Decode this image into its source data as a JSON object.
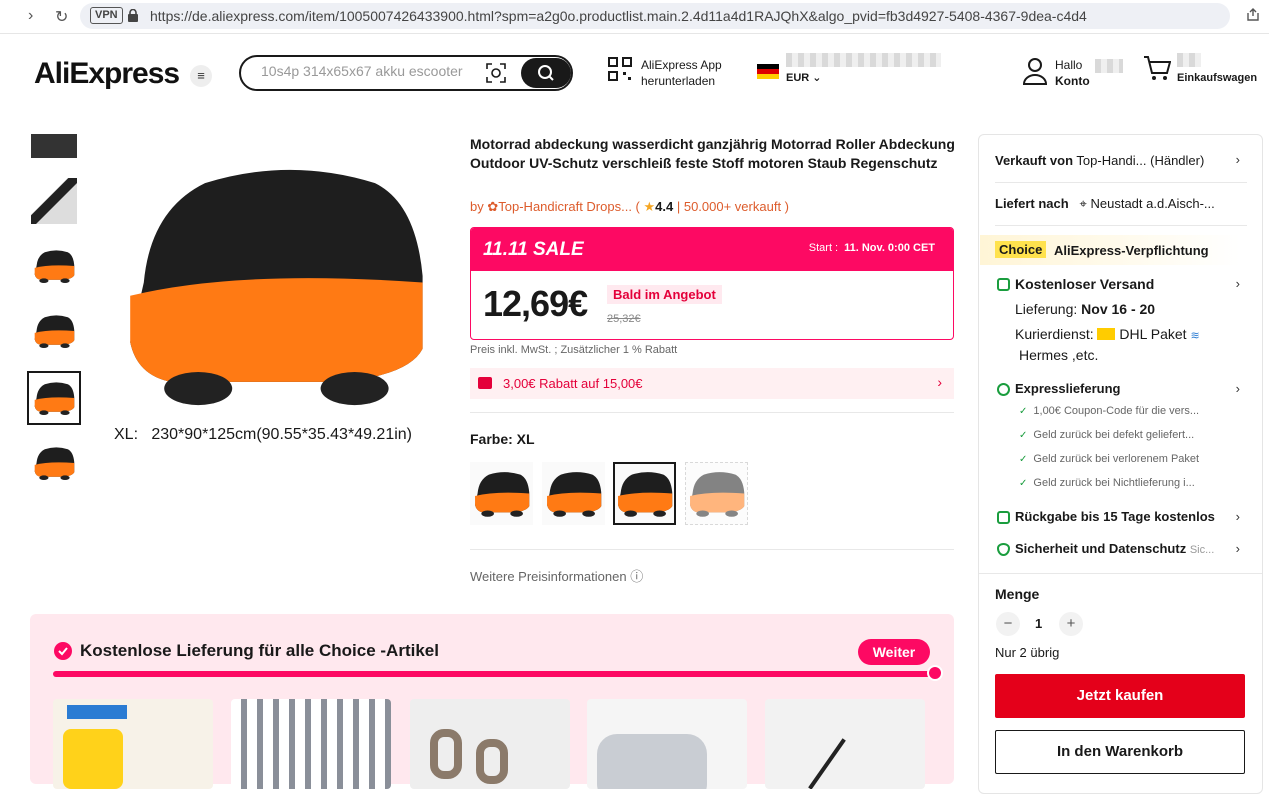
{
  "browser": {
    "vpn_label": "VPN",
    "url": "https://de.aliexpress.com/item/1005007426433900.html?spm=a2g0o.productlist.main.2.4d11a4d1RAJQhX&algo_pvid=fb3d4927-5408-4367-9dea-c4d4"
  },
  "header": {
    "logo": "AliExpress",
    "search_placeholder": "10s4p 314x65x67 akku escooter",
    "app_line1": "AliExpress App",
    "app_line2": "herunterladen",
    "currency": "EUR",
    "account_greeting": "Hallo",
    "account_label": "Konto",
    "cart_label": "Einkaufswagen"
  },
  "gallery": {
    "size_caption": "XL:   230*90*125cm(90.55*35.43*49.21in)"
  },
  "product": {
    "title": "Motorrad abdeckung wasserdicht ganzjährig Motorrad Roller Abdeckung Outdoor UV-Schutz verschleiß feste Stoff motoren Staub Regenschutz",
    "by": "by",
    "store": "Top-Handicraft Drops...",
    "rating": "4.4",
    "sold": "50.000+ verkauft",
    "sale_tag": "11.11 SALE",
    "sale_start_label": "Start :",
    "sale_start_date": "11. Nov. 0:00 CET",
    "price": "12,69€",
    "soon_badge": "Bald im Angebot",
    "old_price": "25,32€",
    "tax_note": "Preis inkl. MwSt. ; Zusätzlicher 1 % Rabatt",
    "coupon": "3,00€ Rabatt auf 15,00€",
    "color_label": "Farbe: XL",
    "more_price_info": "Weitere Preisinformationen"
  },
  "choice_banner": {
    "title": "Kostenlose Lieferung für alle Choice -Artikel",
    "button": "Weiter",
    "progress": 1.0
  },
  "panel": {
    "sold_by_label": "Verkauft von",
    "sold_by_value": "Top-Handi...  (Händler)",
    "ship_to_label": "Liefert nach",
    "ship_to_value": "Neustadt a.d.Aisch-...",
    "choice_tag": "Choice",
    "choice_text": "AliExpress-Verpflichtung",
    "free_shipping": "Kostenloser Versand",
    "delivery_label": "Lieferung:",
    "delivery_dates": "Nov 16 - 20",
    "courier_label": "Kurierdienst:",
    "courier_dhl": "DHL Paket",
    "courier_more": "Hermes ,etc.",
    "express": "Expresslieferung",
    "checks": [
      "1,00€ Coupon-Code für die vers...",
      "Geld zurück bei defekt geliefert...",
      "Geld zurück bei verlorenem Paket",
      "Geld zurück bei Nichtlieferung i..."
    ],
    "returns": "Rückgabe bis 15 Tage kostenlos",
    "security": "Sicherheit und Datenschutz",
    "security_more": "Sic...",
    "qty_label": "Menge",
    "qty_value": "1",
    "stock_note": "Nur 2 übrig",
    "buy_now": "Jetzt kaufen",
    "add_to_cart": "In den Warenkorb"
  },
  "colors": {
    "brand_red": "#fd0963",
    "buy_red": "#e4001a",
    "cover_orange": "#ff7a14",
    "cover_black": "#1e1e1e"
  }
}
